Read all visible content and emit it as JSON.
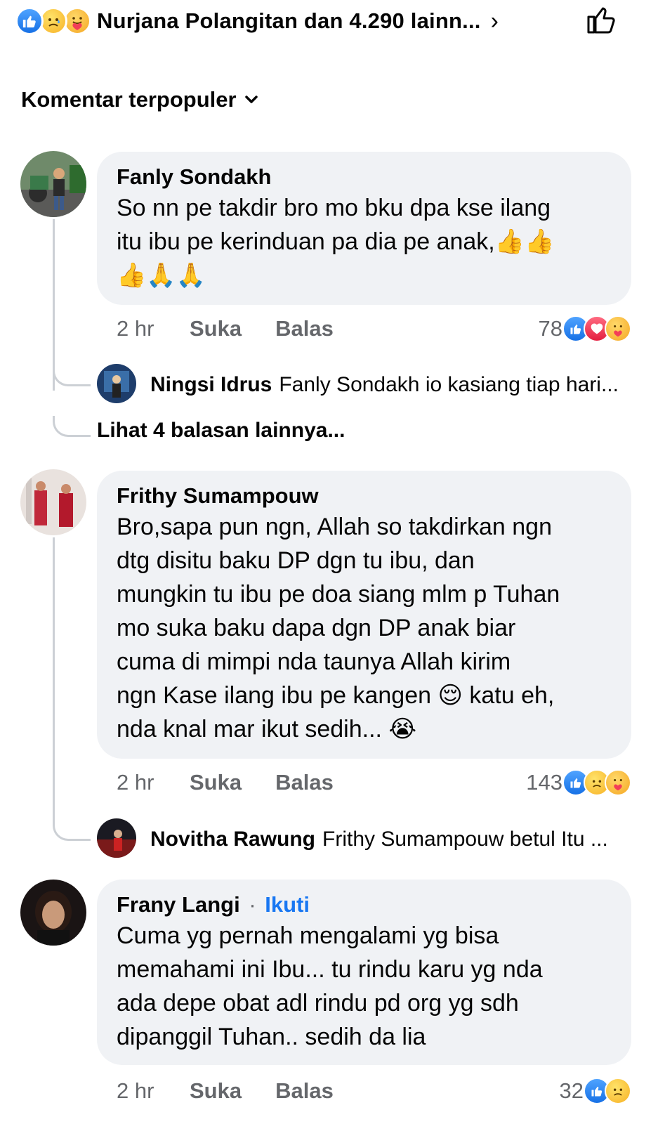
{
  "header": {
    "reactions_text": "Nurjana Polangitan dan 4.290 lainn...",
    "chevron": "›"
  },
  "sort": {
    "label": "Komentar terpopuler"
  },
  "comments": [
    {
      "name": "Fanly Sondakh",
      "text_line1": "So nn pe takdir bro mo bku dpa kse ilang",
      "text_line2": "itu ibu pe kerinduan pa dia pe anak,",
      "emoji_line2": "👍👍",
      "emoji_line3": "👍🙏🙏",
      "time": "2 hr",
      "like_label": "Suka",
      "reply_label": "Balas",
      "reaction_count": "78",
      "reply": {
        "name": "Ningsi Idrus",
        "text": "Fanly Sondakh io kasiang tiap hari..."
      },
      "more_replies": "Lihat 4 balasan lainnya..."
    },
    {
      "name": "Frithy Sumampouw",
      "text_line1": "Bro,sapa pun ngn, Allah so takdirkan ngn",
      "text_line2": "dtg disitu baku DP dgn tu ibu, dan",
      "text_line3": "mungkin tu ibu pe doa siang mlm p Tuhan",
      "text_line4": "mo suka baku dapa dgn DP anak biar",
      "text_line5": "cuma di mimpi nda taunya Allah kirim",
      "text_line6a": "ngn Kase ilang ibu pe kangen",
      "emoji_line6": "😌",
      "text_line6b": "katu eh,",
      "text_line7": "nda knal mar ikut sedih...",
      "emoji_line7": "😭",
      "time": "2 hr",
      "like_label": "Suka",
      "reply_label": "Balas",
      "reaction_count": "143",
      "reply": {
        "name": "Novitha Rawung",
        "text": "Frithy Sumampouw betul Itu ..."
      }
    },
    {
      "name": "Frany Langi",
      "follow_dot": "·",
      "follow_label": "Ikuti",
      "text_line1": "Cuma yg pernah mengalami yg bisa",
      "text_line2": "memahami ini Ibu... tu rindu karu yg nda",
      "text_line3": "ada depe obat adl rindu pd org yg sdh",
      "text_line4": "dipanggil Tuhan.. sedih da lia",
      "time": "2 hr",
      "like_label": "Suka",
      "reply_label": "Balas",
      "reaction_count": "32"
    }
  ],
  "icons": [
    "like-reaction-icon",
    "sad-reaction-icon",
    "care-reaction-icon",
    "love-reaction-icon",
    "thumbs-up-outline-icon",
    "chevron-down-icon"
  ],
  "colors": {
    "link_blue": "#1877f2",
    "bubble_bg": "#f0f2f5",
    "meta_gray": "#65676b",
    "thread_line": "#ccd0d5"
  }
}
